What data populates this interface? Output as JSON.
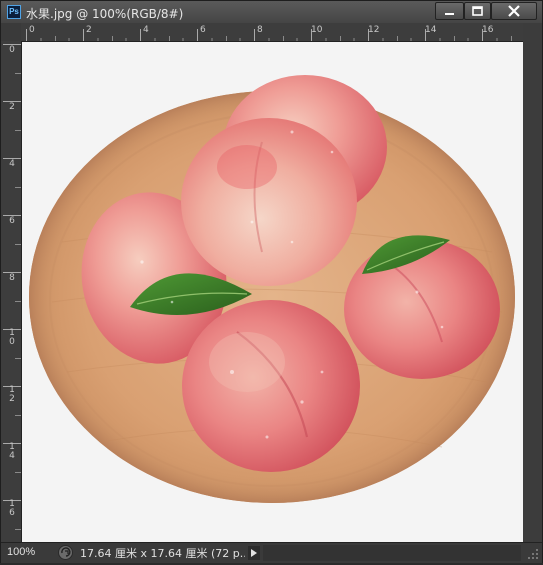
{
  "window": {
    "app_badge": "Ps",
    "title": "水果.jpg @ 100%(RGB/8#)"
  },
  "controls": {
    "minimize_icon": "minimize-icon",
    "maximize_icon": "maximize-icon",
    "close_icon": "close-icon"
  },
  "rulers": {
    "horizontal": [
      "0",
      "2",
      "4",
      "6",
      "8",
      "10",
      "12",
      "14",
      "16"
    ],
    "vertical": [
      "0",
      "2",
      "4",
      "6",
      "8",
      "1\n0",
      "1\n2",
      "1\n4",
      "1\n6"
    ]
  },
  "status": {
    "zoom": "100%",
    "doc_size": "17.64 厘米 x 17.64 厘米 (72 p..."
  },
  "colors": {
    "canvas_bg": "#f4f4f4",
    "plate": "#d9a072",
    "peach": "#e8787a",
    "leaf": "#3a7d2a"
  }
}
